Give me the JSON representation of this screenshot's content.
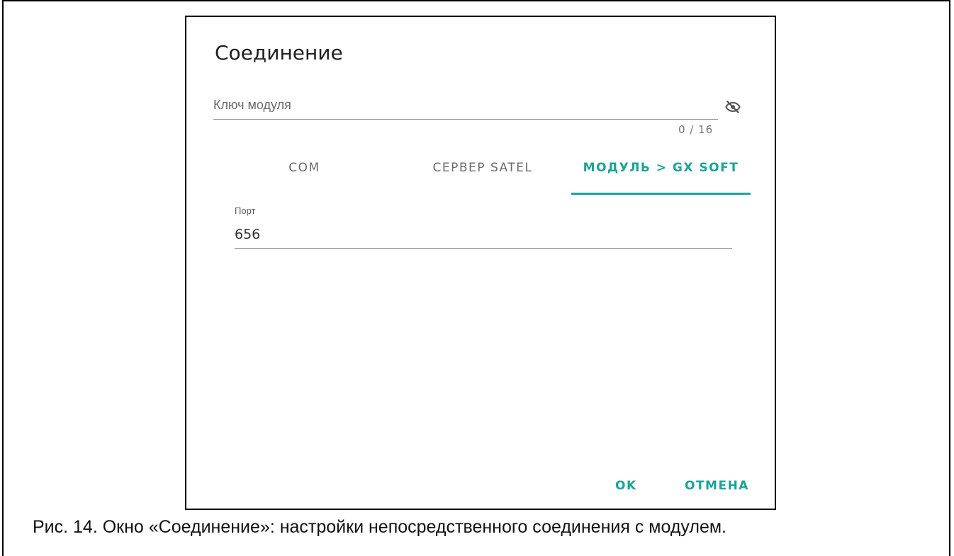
{
  "dialog": {
    "title": "Соединение",
    "module_key": {
      "placeholder": "Ключ модуля",
      "value": "",
      "counter": "0 / 16",
      "visibility_icon": "eye-off-icon"
    },
    "tabs": [
      {
        "label": "COM",
        "active": false
      },
      {
        "label": "СЕРВЕР SATEL",
        "active": false
      },
      {
        "label": "МОДУЛЬ > GX SOFT",
        "active": true
      }
    ],
    "port": {
      "label": "Порт",
      "value": "656"
    },
    "buttons": {
      "ok": "OK",
      "cancel": "ОТМЕНА"
    }
  },
  "caption": "Рис. 14. Окно «Соединение»: настройки непосредственного соединения с модулем.",
  "colors": {
    "accent": "#1aa398",
    "text": "#202020",
    "muted": "#6b6b6b"
  }
}
